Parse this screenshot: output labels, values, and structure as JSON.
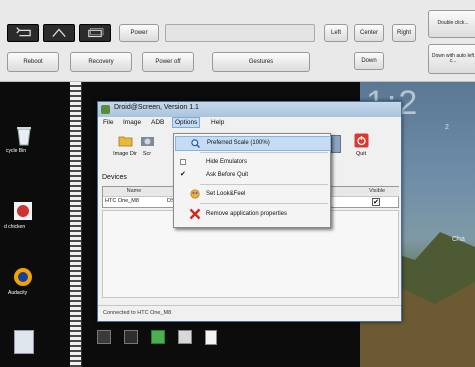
{
  "controls": {
    "power_label": "Power",
    "left_label": "Left",
    "center_label": "Center",
    "right_label": "Right",
    "reboot_label": "Reboot",
    "recovery_label": "Recovery",
    "poweroff_label": "Power off",
    "gestures_label": "Gestures",
    "down_label": "Down",
    "side_top_label": "Double click...",
    "side_bottom_label": "Down with auto left c..."
  },
  "desktop": {
    "recycle_label": "cycle Bin",
    "chicken_label": "d chicken",
    "audacity_label": "Audacity",
    "taskbar_labels": [
      "",
      "",
      "",
      "",
      ""
    ]
  },
  "window": {
    "title": "Droid@Screen, Version 1.1",
    "menu": [
      "File",
      "Image",
      "ADB",
      "Options",
      "Help"
    ],
    "toolbar": {
      "image_dir_label": "Image Dir",
      "screenshot_label": "Scr",
      "quit_label": "Quit"
    },
    "devices_header": "Devices",
    "table": {
      "col_name": "Name",
      "col_visible": "Visible",
      "row_name": "HTC One_M8",
      "row_serial": "DS"
    },
    "status_text": "Connected to HTC One_M8"
  },
  "options_menu": {
    "items": [
      {
        "label": "Preferred Scale (100%)",
        "checked": false,
        "highlighted": true
      },
      {
        "label": "Hide Emulators",
        "checked": false
      },
      {
        "label": "Ask Before Quit",
        "checked": true
      },
      {
        "label": "Set Look&Feel",
        "checked": false
      },
      {
        "label": "Remove application properties",
        "checked": false
      }
    ]
  },
  "wallpaper": {
    "clock_text": "1:2",
    "side_caption_1": "2",
    "side_caption_2": "Cha"
  },
  "colors": {
    "accent": "#c6dcf4",
    "titlebar": "#a9c4de",
    "quit_red": "#d93a2f"
  }
}
